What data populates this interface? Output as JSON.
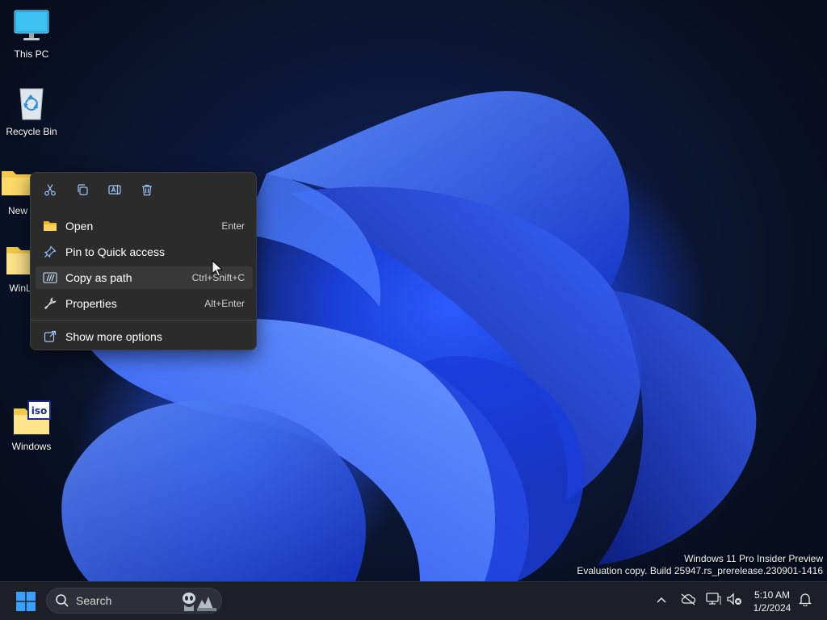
{
  "desktop": {
    "icons": [
      {
        "label": "This PC",
        "icon": "monitor-icon"
      },
      {
        "label": "Recycle Bin",
        "icon": "recycle-bin-icon"
      },
      {
        "label": "New",
        "icon": "folder-icon"
      },
      {
        "label": "WinLit",
        "icon": "folder-icon"
      },
      {
        "label": "Windows",
        "icon": "iso-folder-icon"
      }
    ]
  },
  "context_menu": {
    "quick_actions": [
      {
        "name": "cut",
        "icon": "scissors-icon"
      },
      {
        "name": "copy",
        "icon": "copy-icon"
      },
      {
        "name": "rename",
        "icon": "rename-icon"
      },
      {
        "name": "delete",
        "icon": "trash-icon"
      }
    ],
    "items": [
      {
        "label": "Open",
        "shortcut": "Enter",
        "icon": "folder-open-icon"
      },
      {
        "label": "Pin to Quick access",
        "shortcut": "",
        "icon": "pin-icon"
      },
      {
        "label": "Copy as path",
        "shortcut": "Ctrl+Shift+C",
        "icon": "copy-path-icon"
      },
      {
        "label": "Properties",
        "shortcut": "Alt+Enter",
        "icon": "wrench-icon"
      }
    ],
    "more": {
      "label": "Show more options",
      "icon": "share-icon"
    }
  },
  "watermark": {
    "line1": "Windows 11 Pro Insider Preview",
    "line2": "Evaluation copy. Build 25947.rs_prerelease.230901-1416"
  },
  "taskbar": {
    "search_label": "Search",
    "time": "5:10 AM",
    "date": "1/2/2024"
  },
  "colors": {
    "accent": "#3aa0ff",
    "menu_bg": "#2b2b2b",
    "taskbar_bg": "#1c1f26"
  }
}
